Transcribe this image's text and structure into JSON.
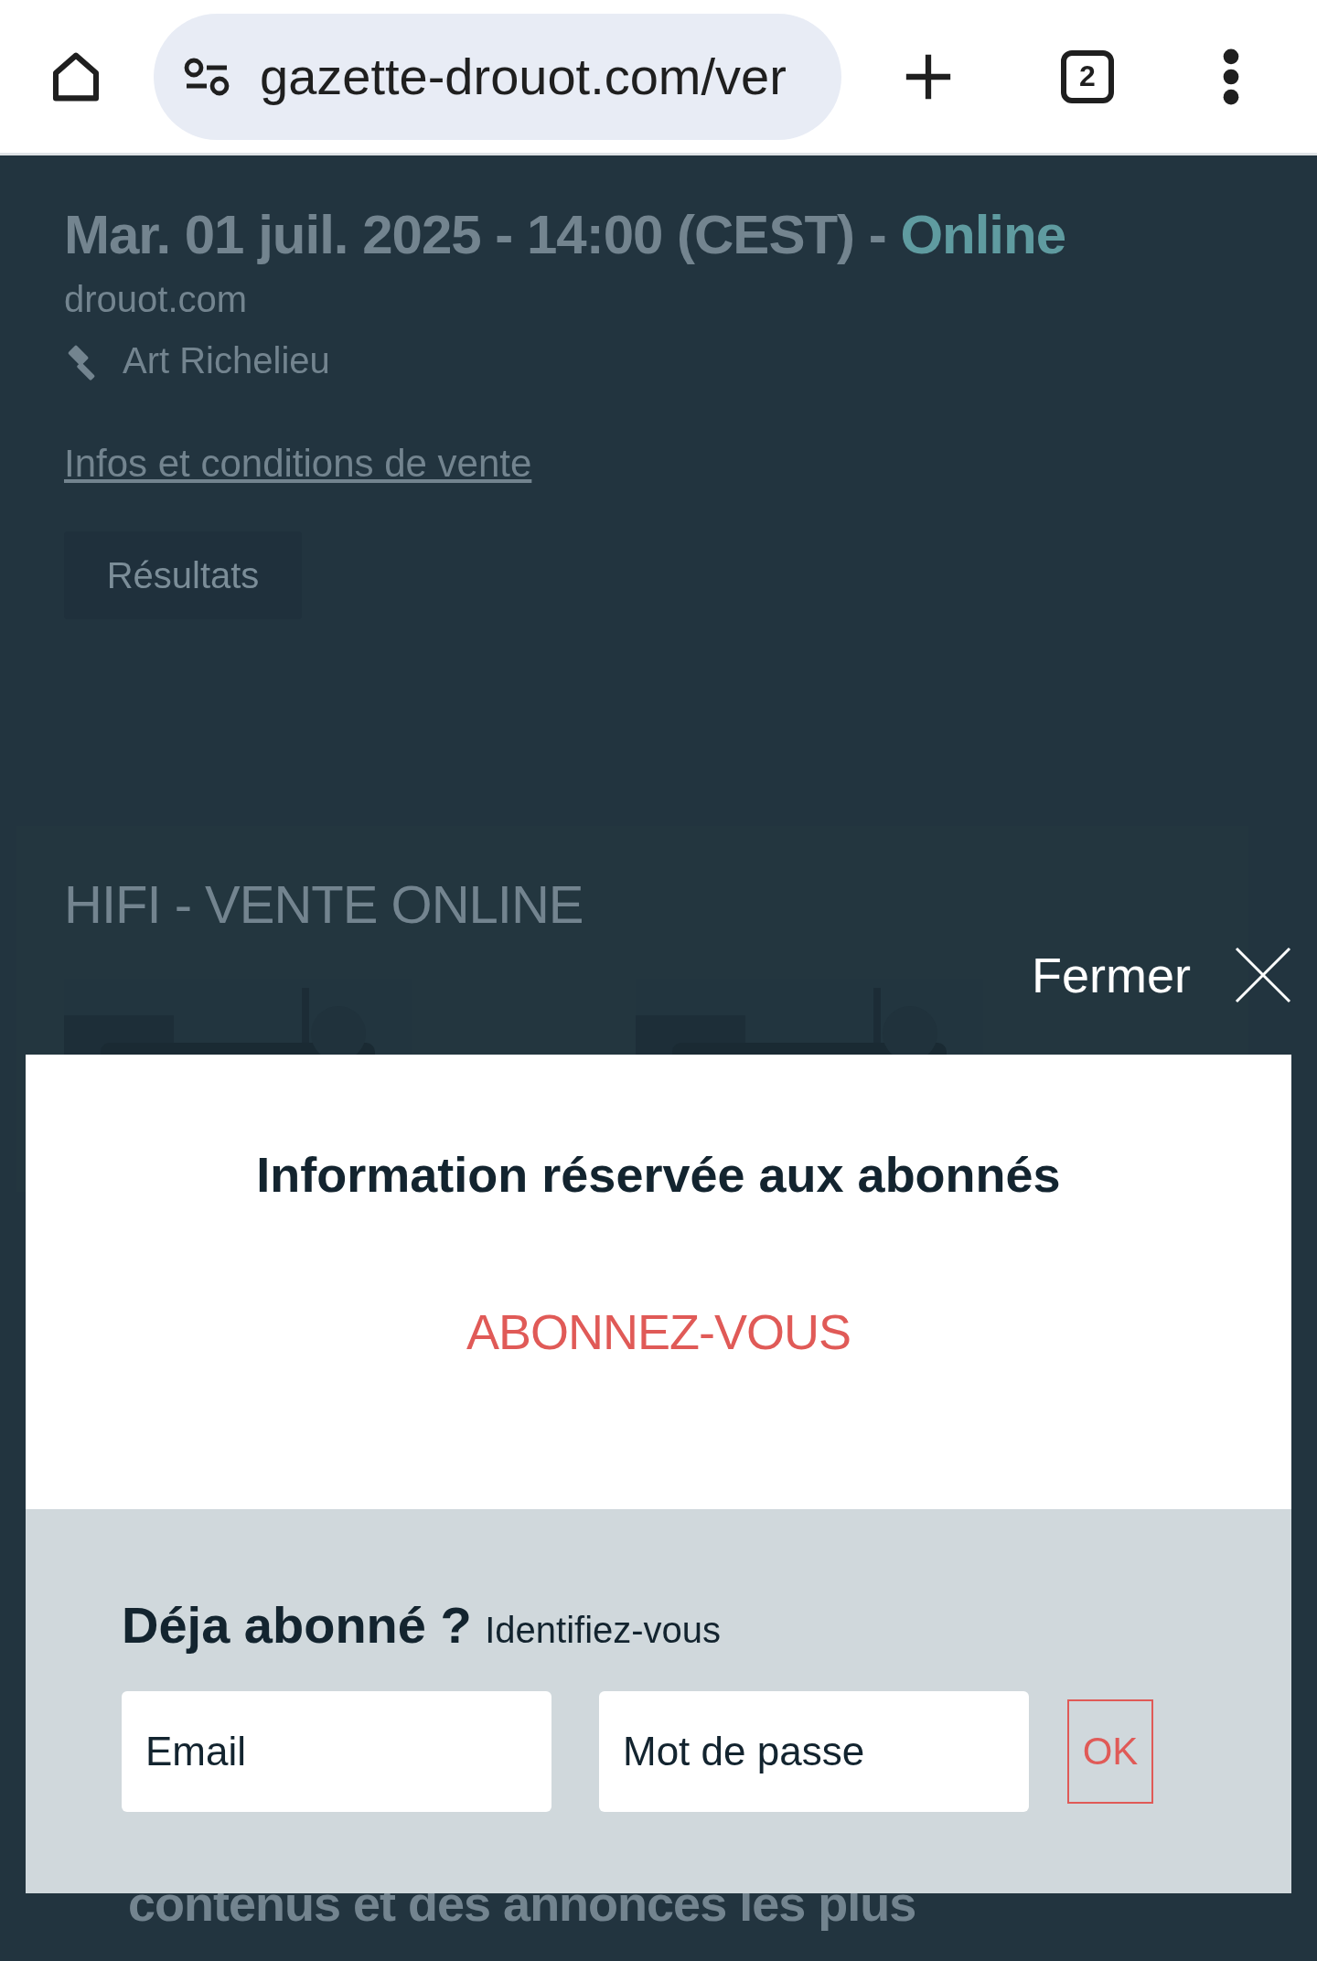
{
  "browser": {
    "url": "gazette-drouot.com/ver",
    "tab_count": "2"
  },
  "sale": {
    "date": "Mar. 01 juil. 2025 - 14:00 (CEST) -",
    "mode": "Online",
    "site": "drouot.com",
    "auctioneer": "Art Richelieu",
    "link": "Infos et conditions de vente",
    "results_button": "Résultats"
  },
  "section": {
    "title": "HIFI - VENTE ONLINE"
  },
  "modal": {
    "close_label": "Fermer",
    "title": "Information réservée aux abonnés",
    "subscribe": "ABONNEZ-VOUS",
    "login_heading": "Déja abonné ?",
    "login_hint": "Identifiez-vous",
    "email_placeholder": "Email",
    "password_placeholder": "Mot de passe",
    "submit": "OK"
  },
  "background_text": "contenus et des annonces les plus"
}
